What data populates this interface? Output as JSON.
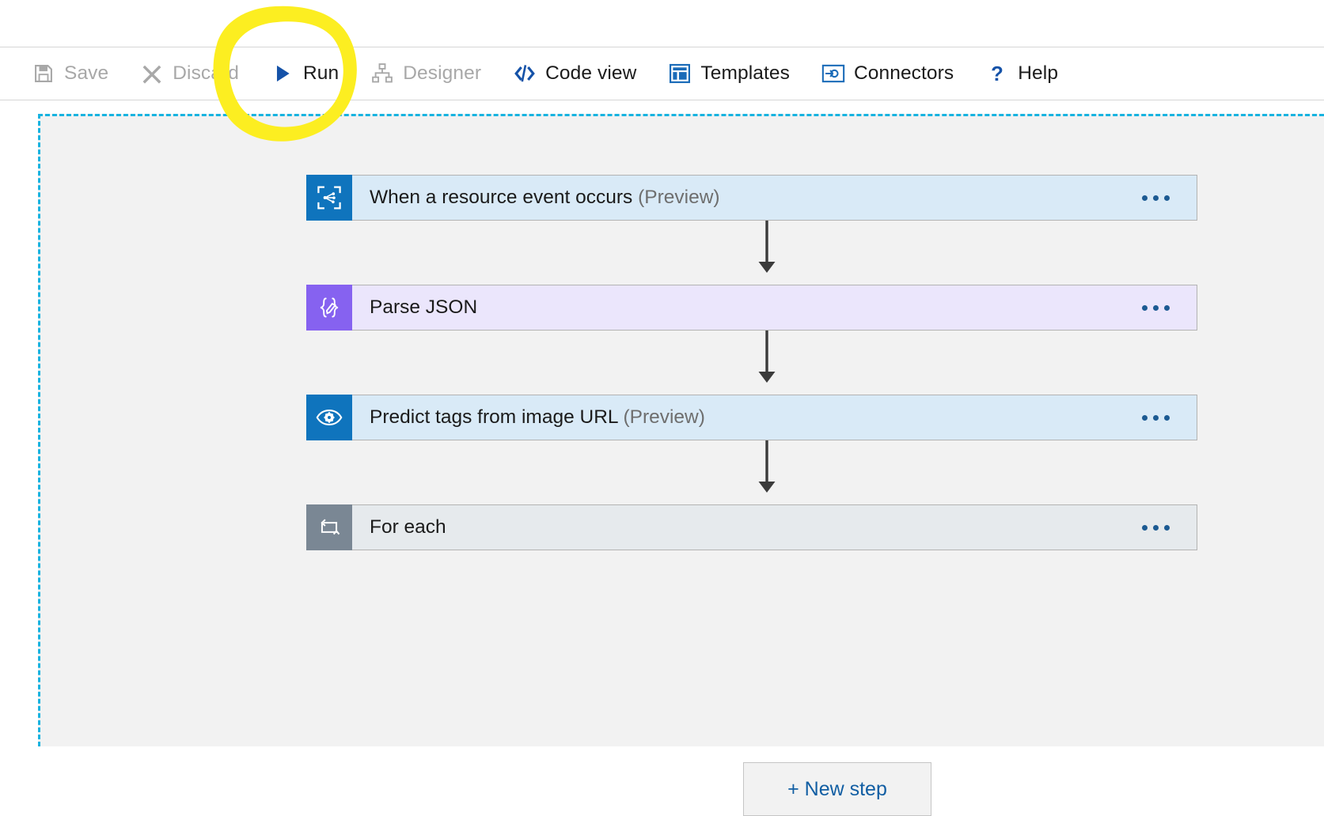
{
  "toolbar": {
    "items": [
      {
        "id": "save",
        "label": "Save",
        "icon": "save-icon",
        "state": "disabled"
      },
      {
        "id": "discard",
        "label": "Discard",
        "icon": "close-x-icon",
        "state": "disabled"
      },
      {
        "id": "run",
        "label": "Run",
        "icon": "play-run-icon",
        "state": "enabled"
      },
      {
        "id": "designer",
        "label": "Designer",
        "icon": "sitemap-icon",
        "state": "disabled"
      },
      {
        "id": "code-view",
        "label": "Code view",
        "icon": "code-brackets-icon",
        "state": "enabled"
      },
      {
        "id": "templates",
        "label": "Templates",
        "icon": "templates-icon",
        "state": "enabled"
      },
      {
        "id": "connectors",
        "label": "Connectors",
        "icon": "connectors-icon",
        "state": "enabled"
      },
      {
        "id": "help",
        "label": "Help",
        "icon": "question-mark-icon",
        "state": "enabled"
      }
    ]
  },
  "designer": {
    "steps": [
      {
        "id": "when-a-resource-event-occurs",
        "title": "When a resource event occurs",
        "suffix": "(Preview)",
        "icon": "event-grid-icon",
        "theme": "blue",
        "menu": "…"
      },
      {
        "id": "parse-json",
        "title": "Parse JSON",
        "suffix": "",
        "icon": "parse-json-braces-icon",
        "theme": "purple",
        "menu": "…"
      },
      {
        "id": "predict-tags-from-image-url",
        "title": "Predict tags from image URL",
        "suffix": "(Preview)",
        "icon": "computer-vision-eye-icon",
        "theme": "blue",
        "menu": "…"
      },
      {
        "id": "for-each",
        "title": "For each",
        "suffix": "",
        "icon": "loop-for-each-icon",
        "theme": "gray",
        "menu": "…"
      }
    ],
    "new_step_label": "+ New step"
  },
  "annotation": {
    "shape": "hand-drawn-ellipse",
    "target": "run-button",
    "color": "#fcee21"
  },
  "colors": {
    "accent_blue": "#0f6cbd",
    "link_blue": "#115ea3",
    "card_blue_bg": "#d9eaf7",
    "card_purple_bg": "#ebe6fc",
    "card_gray_bg": "#e6eaed",
    "icon_blue": "#0f74bd",
    "icon_purple": "#8662f0",
    "icon_gray": "#7a8794",
    "canvas_bg": "#f2f2f2",
    "canvas_border": "#18b3e0",
    "disabled_text": "#a8a8a8",
    "arrow": "#3b3b3b",
    "highlight_yellow": "#fcee21"
  }
}
